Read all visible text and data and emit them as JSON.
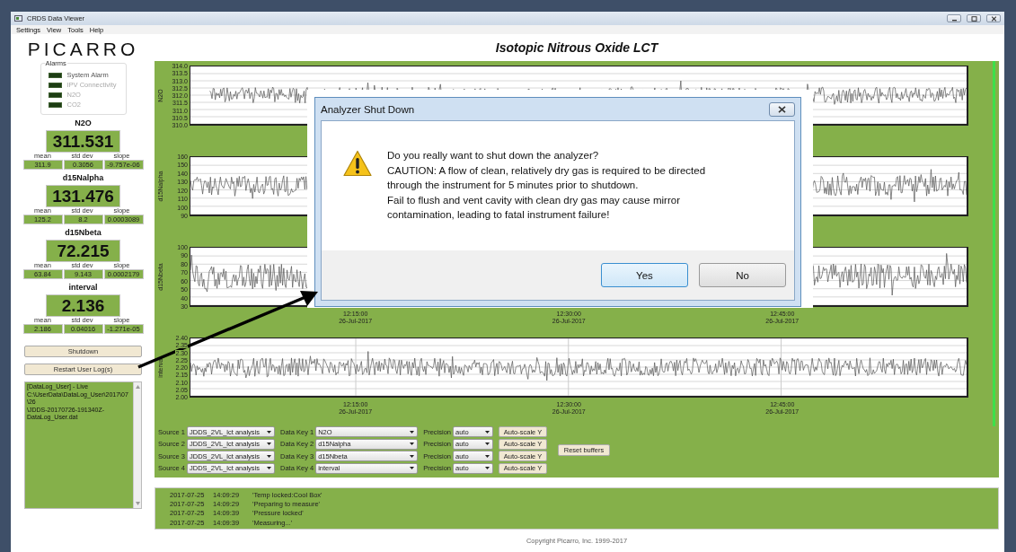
{
  "window": {
    "title": "CRDS Data Viewer"
  },
  "menu": [
    "Settings",
    "View",
    "Tools",
    "Help"
  ],
  "logo": "PICARRO",
  "page_title": "Isotopic Nitrous Oxide LCT",
  "alarms": {
    "title": "Alarms",
    "items": [
      {
        "label": "System Alarm",
        "disabled": false
      },
      {
        "label": "IPV Connectivity",
        "disabled": true
      },
      {
        "label": "N2O",
        "disabled": true
      },
      {
        "label": "CO2",
        "disabled": true
      }
    ]
  },
  "readouts": [
    {
      "name": "N2O",
      "value": "311.531",
      "stats": [
        {
          "label": "mean",
          "value": "311.9"
        },
        {
          "label": "std dev",
          "value": "0.3056"
        },
        {
          "label": "slope",
          "value": "-9.757e-06"
        }
      ]
    },
    {
      "name": "d15Nalpha",
      "value": "131.476",
      "stats": [
        {
          "label": "mean",
          "value": "125.2"
        },
        {
          "label": "std dev",
          "value": "8.2"
        },
        {
          "label": "slope",
          "value": "0.0003089"
        }
      ]
    },
    {
      "name": "d15Nbeta",
      "value": "72.215",
      "stats": [
        {
          "label": "mean",
          "value": "63.84"
        },
        {
          "label": "std dev",
          "value": "9.143"
        },
        {
          "label": "slope",
          "value": "0.0002179"
        }
      ]
    },
    {
      "name": "interval",
      "value": "2.136",
      "stats": [
        {
          "label": "mean",
          "value": "2.186"
        },
        {
          "label": "std dev",
          "value": "0.04016"
        },
        {
          "label": "slope",
          "value": "-1.271e-05"
        }
      ]
    }
  ],
  "buttons": [
    {
      "label": "Shutdown"
    },
    {
      "label": "Restart User Log(s)"
    }
  ],
  "log_file": {
    "lines": [
      "[DataLog_User] - Live",
      "C:\\UserData\\DataLog_User\\2017\\07\\26",
      "\\JDDS-20170726-191340Z-",
      "DataLog_User.dat"
    ]
  },
  "charts": [
    {
      "ylabel": "N2O",
      "yticks": [
        "314.0",
        "313.5",
        "313.0",
        "312.5",
        "312.0",
        "311.5",
        "311.0",
        "310.5",
        "310.0"
      ]
    },
    {
      "ylabel": "d15Nalpha",
      "yticks": [
        "160",
        "150",
        "140",
        "130",
        "120",
        "110",
        "100",
        "90"
      ]
    },
    {
      "ylabel": "d15Nbeta",
      "yticks": [
        "100",
        "90",
        "80",
        "70",
        "60",
        "50",
        "40",
        "30"
      ],
      "xticks": [
        {
          "time": "12:15:00",
          "date": "26-Jul-2017"
        },
        {
          "time": "12:30:00",
          "date": "26-Jul-2017"
        },
        {
          "time": "12:45:00",
          "date": "26-Jul-2017"
        }
      ]
    },
    {
      "ylabel": "interval",
      "yticks": [
        "2.40",
        "2.35",
        "2.30",
        "2.25",
        "2.20",
        "2.15",
        "2.10",
        "2.05",
        "2.00"
      ],
      "xticks": [
        {
          "time": "12:15:00",
          "date": "26-Jul-2017"
        },
        {
          "time": "12:30:00",
          "date": "26-Jul-2017"
        },
        {
          "time": "12:45:00",
          "date": "26-Jul-2017"
        }
      ]
    }
  ],
  "controls": [
    {
      "source_label": "Source 1",
      "source": "JDDS_2VL_lct analysis",
      "key_label": "Data Key 1",
      "key": "N2O",
      "precision_label": "Precision",
      "precision": "auto",
      "autoscale": "Auto-scale Y"
    },
    {
      "source_label": "Source 2",
      "source": "JDDS_2VL_lct analysis",
      "key_label": "Data Key 2",
      "key": "d15Nalpha",
      "precision_label": "Precision",
      "precision": "auto",
      "autoscale": "Auto-scale Y"
    },
    {
      "source_label": "Source 3",
      "source": "JDDS_2VL_lct analysis",
      "key_label": "Data Key 3",
      "key": "d15Nbeta",
      "precision_label": "Precision",
      "precision": "auto",
      "autoscale": "Auto-scale Y"
    },
    {
      "source_label": "Source 4",
      "source": "JDDS_2VL_lct analysis",
      "key_label": "Data Key 4",
      "key": "interval",
      "precision_label": "Precision",
      "precision": "auto",
      "autoscale": "Auto-scale Y"
    }
  ],
  "reset_button": "Reset buffers",
  "messages": [
    {
      "date": "2017-07-25",
      "time": "14:09:29",
      "text": "'Temp locked:Cool Box'"
    },
    {
      "date": "2017-07-25",
      "time": "14:09:29",
      "text": "'Preparing to measure'"
    },
    {
      "date": "2017-07-25",
      "time": "14:09:39",
      "text": "'Pressure locked'"
    },
    {
      "date": "2017-07-25",
      "time": "14:09:39",
      "text": "'Measuring...'"
    }
  ],
  "copyright": "Copyright Picarro, Inc. 1999-2017",
  "dialog": {
    "title": "Analyzer Shut Down",
    "lines": [
      "Do you really want to shut down the analyzer?",
      "CAUTION: A flow of clean, relatively dry gas is required to be directed",
      "through the instrument for 5 minutes prior to shutdown.",
      "Fail to flush and vent cavity with clean dry gas may cause mirror",
      "contamination, leading to fatal instrument failure!"
    ],
    "buttons": [
      {
        "label": "Yes",
        "selected": true
      },
      {
        "label": "No",
        "selected": false
      }
    ]
  }
}
